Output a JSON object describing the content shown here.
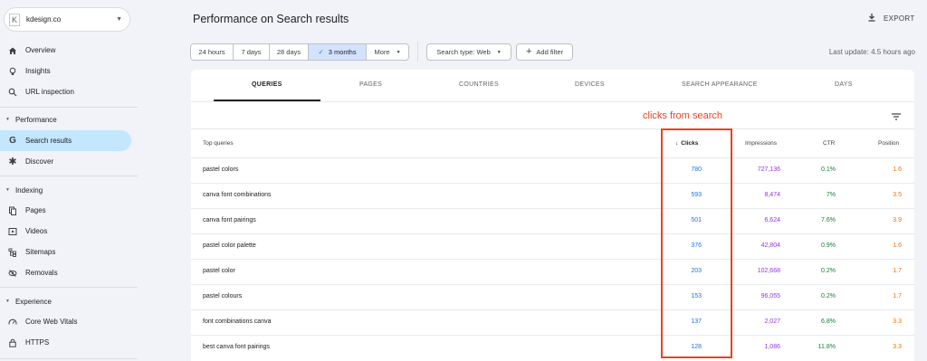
{
  "property": {
    "logo": "K",
    "name": "kdesign.co"
  },
  "nav": {
    "overview": "Overview",
    "insights": "Insights",
    "url_inspection": "URL inspection",
    "performance_section": "Performance",
    "search_results": "Search results",
    "discover": "Discover",
    "indexing_section": "Indexing",
    "pages": "Pages",
    "videos": "Videos",
    "sitemaps": "Sitemaps",
    "removals": "Removals",
    "experience_section": "Experience",
    "core_web_vitals": "Core Web Vitals",
    "https": "HTTPS"
  },
  "header": {
    "title": "Performance on Search results",
    "export": "EXPORT"
  },
  "filters": {
    "ranges": [
      "24 hours",
      "7 days",
      "28 days",
      "3 months"
    ],
    "selected_check": "✓",
    "more": "More",
    "search_type": "Search type: Web",
    "add_filter": "Add filter",
    "last_update": "Last update: 4.5 hours ago"
  },
  "tabs": [
    "QUERIES",
    "PAGES",
    "COUNTRIES",
    "DEVICES",
    "SEARCH APPEARANCE",
    "DAYS"
  ],
  "annotation": "clicks from search",
  "table": {
    "headers": {
      "query": "Top queries",
      "clicks": "Clicks",
      "impressions": "Impressions",
      "ctr": "CTR",
      "position": "Position"
    },
    "sort_arrow": "↓",
    "rows": [
      {
        "query": "pastel colors",
        "clicks": "780",
        "impressions": "727,136",
        "ctr": "0.1%",
        "position": "1.6"
      },
      {
        "query": "canva font combinations",
        "clicks": "593",
        "impressions": "8,474",
        "ctr": "7%",
        "position": "3.5"
      },
      {
        "query": "canva font pairings",
        "clicks": "501",
        "impressions": "6,624",
        "ctr": "7.6%",
        "position": "3.9"
      },
      {
        "query": "pastel color palette",
        "clicks": "376",
        "impressions": "42,804",
        "ctr": "0.9%",
        "position": "1.6"
      },
      {
        "query": "pastel color",
        "clicks": "203",
        "impressions": "102,668",
        "ctr": "0.2%",
        "position": "1.7"
      },
      {
        "query": "pastel colours",
        "clicks": "153",
        "impressions": "96,055",
        "ctr": "0.2%",
        "position": "1.7"
      },
      {
        "query": "font combinations canva",
        "clicks": "137",
        "impressions": "2,027",
        "ctr": "6.8%",
        "position": "3.3"
      },
      {
        "query": "best canva font pairings",
        "clicks": "128",
        "impressions": "1,086",
        "ctr": "11.8%",
        "position": "3.3"
      }
    ]
  },
  "colors": {
    "clicks": "#1a73e8",
    "impressions": "#9334e6",
    "ctr": "#188038",
    "position": "#e8710a",
    "annotation": "#e8431f",
    "active_nav": "#c2e7ff",
    "selected_chip": "#d3e3fd"
  }
}
